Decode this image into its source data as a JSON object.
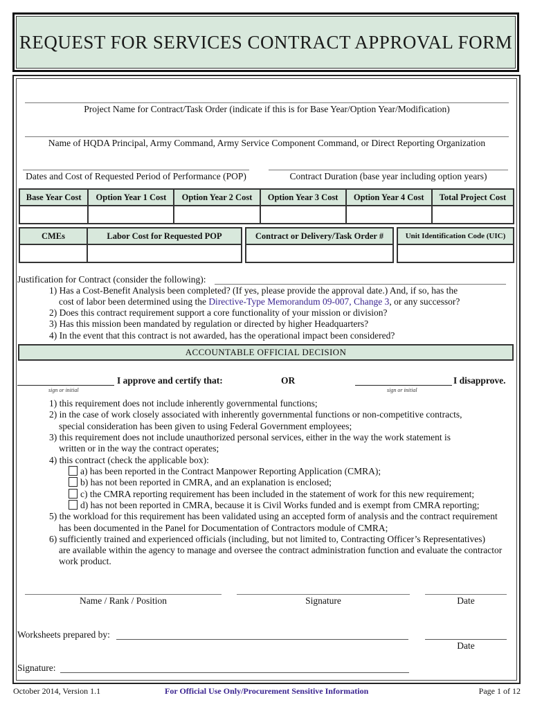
{
  "title": "Request for Services Contract Approval Form",
  "fields": {
    "project_name_label": "Project Name for Contract/Task Order (indicate if this is for Base Year/Option Year/Modification)",
    "hqda_label": "Name of HQDA Principal, Army Command, Army Service Component Command, or Direct Reporting Organization",
    "pop_label": "Dates and Cost of Requested Period of Performance (POP)",
    "duration_label": "Contract Duration (base year including option years)"
  },
  "cost_table": {
    "headers": [
      "Base Year Cost",
      "Option Year 1 Cost",
      "Option Year 2 Cost",
      "Option Year 3 Cost",
      "Option Year 4 Cost",
      "Total Project Cost"
    ]
  },
  "labor_table": {
    "headers": [
      "CMEs",
      "Labor Cost for Requested POP"
    ]
  },
  "order_table": {
    "headers": [
      "Contract or Delivery/Task Order #"
    ]
  },
  "uic_table": {
    "headers": [
      "Unit Identification Code (UIC)"
    ]
  },
  "justification": {
    "label": "Justification for Contract (consider the following):",
    "item1_line1": "1) Has a Cost-Benefit Analysis been completed? (If yes, please provide the approval date.) And, if so, has the",
    "item1_line2_prefix": "cost of labor been determined using the ",
    "item1_link": "Directive-Type Memorandum 09-007, Change 3",
    "item1_line2_suffix": ", or any successor?",
    "item2": "2) Does this contract requirement support a core functionality of your mission or division?",
    "item3": "3) Has this mission been mandated by regulation or directed by higher Headquarters?",
    "item4": "4) In the event that this contract is not awarded, has the operational impact been considered?"
  },
  "decision": {
    "section_title": "Accountable Official Decision",
    "approve_label": "I approve and certify that:",
    "or_label": "OR",
    "disapprove_label": "I disapprove.",
    "sign_hint": "sign or initial",
    "items": {
      "i1": "1) this requirement does not include inherently governmental functions;",
      "i2a": "2) in the case of work closely associated with inherently governmental functions or non-competitive contracts,",
      "i2b": "special consideration has been given to using Federal Government employees;",
      "i3a": "3) this requirement does not include unauthorized personal services, either in the way the work statement is",
      "i3b": "written or in the way the contract operates;",
      "i4": "4) this contract (check the applicable box):",
      "i4a": "a) has been reported in the Contract Manpower Reporting Application (CMRA);",
      "i4b": "b) has not been reported in CMRA, and an explanation is enclosed;",
      "i4c": "c) the CMRA reporting requirement has been included in the statement of work for this new requirement;",
      "i4d": "d) has not been reported in CMRA, because it is Civil Works funded and is exempt from CMRA reporting;",
      "i5a": "5) the workload for this requirement has been validated using an accepted form of analysis and the contract requirement",
      "i5b": "has been documented in the Panel for Documentation of Contractors module of CMRA;",
      "i6a": "6) sufficiently trained and experienced officials (including, but not limited to, Contracting Officer’s Representatives)",
      "i6b": "are available within the agency to manage and oversee the contract administration function and evaluate the contractor",
      "i6c": "work product."
    }
  },
  "signature_block": {
    "name_label": "Name / Rank / Position",
    "signature_label": "Signature",
    "date_label": "Date",
    "worksheets_label": "Worksheets prepared by:",
    "date2_label": "Date",
    "signature2_label": "Signature:"
  },
  "footer": {
    "left": "October 2014, Version 1.1",
    "center": "For Official Use Only/Procurement Sensitive Information",
    "right": "Page 1 of 12"
  }
}
